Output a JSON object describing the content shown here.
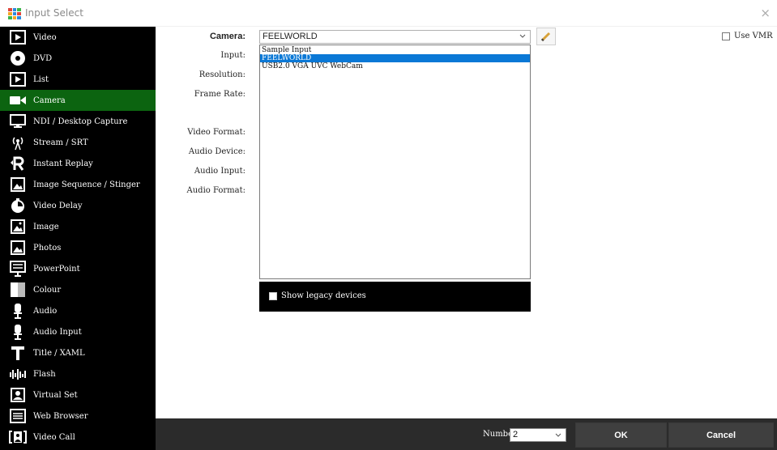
{
  "window": {
    "title": "Input Select",
    "close_glyph": "×",
    "icon": "vmix-grid-icon"
  },
  "sidebar": {
    "items": [
      {
        "label": "Video",
        "icon": "video-icon",
        "active": false
      },
      {
        "label": "DVD",
        "icon": "disc-icon",
        "active": false
      },
      {
        "label": "List",
        "icon": "list-icon",
        "active": false
      },
      {
        "label": "Camera",
        "icon": "camera-icon",
        "active": true
      },
      {
        "label": "NDI / Desktop Capture",
        "icon": "monitor-icon",
        "active": false
      },
      {
        "label": "Stream / SRT",
        "icon": "broadcast-icon",
        "active": false
      },
      {
        "label": "Instant Replay",
        "icon": "replay-icon",
        "active": false
      },
      {
        "label": "Image Sequence / Stinger",
        "icon": "image-sequence-icon",
        "active": false
      },
      {
        "label": "Video Delay",
        "icon": "timer-icon",
        "active": false
      },
      {
        "label": "Image",
        "icon": "image-icon",
        "active": false
      },
      {
        "label": "Photos",
        "icon": "photos-icon",
        "active": false
      },
      {
        "label": "PowerPoint",
        "icon": "presentation-icon",
        "active": false
      },
      {
        "label": "Colour",
        "icon": "colour-icon",
        "active": false
      },
      {
        "label": "Audio",
        "icon": "microphone-icon",
        "active": false
      },
      {
        "label": "Audio Input",
        "icon": "microphone-input-icon",
        "active": false
      },
      {
        "label": "Title / XAML",
        "icon": "title-icon",
        "active": false
      },
      {
        "label": "Flash",
        "icon": "flash-icon",
        "active": false
      },
      {
        "label": "Virtual Set",
        "icon": "virtual-set-icon",
        "active": false
      },
      {
        "label": "Web Browser",
        "icon": "web-browser-icon",
        "active": false
      },
      {
        "label": "Video Call",
        "icon": "video-call-icon",
        "active": false
      }
    ]
  },
  "form": {
    "labels": {
      "camera": "Camera:",
      "input": "Input:",
      "resolution": "Resolution:",
      "frame_rate": "Frame Rate:",
      "video_format": "Video Format:",
      "audio_device": "Audio Device:",
      "audio_input": "Audio Input:",
      "audio_format": "Audio Format:"
    },
    "camera_value": "FEELWORLD",
    "camera_options": [
      "Sample Input",
      "FEELWORLD",
      "USB2.0 VGA UVC WebCam"
    ],
    "camera_selected_index": 1,
    "show_legacy_label": "Show legacy devices",
    "show_legacy_checked": false,
    "use_vmr_label": "Use VMR",
    "use_vmr_checked": false
  },
  "footer": {
    "number_label": "Number",
    "number_value": "2",
    "ok_label": "OK",
    "cancel_label": "Cancel"
  },
  "colors": {
    "sidebar_bg": "#000000",
    "active_item_bg": "#0c6410",
    "selected_option_bg": "#0a78d6",
    "footer_bg": "#2b2b2b",
    "button_bg": "#3f3f3f"
  }
}
